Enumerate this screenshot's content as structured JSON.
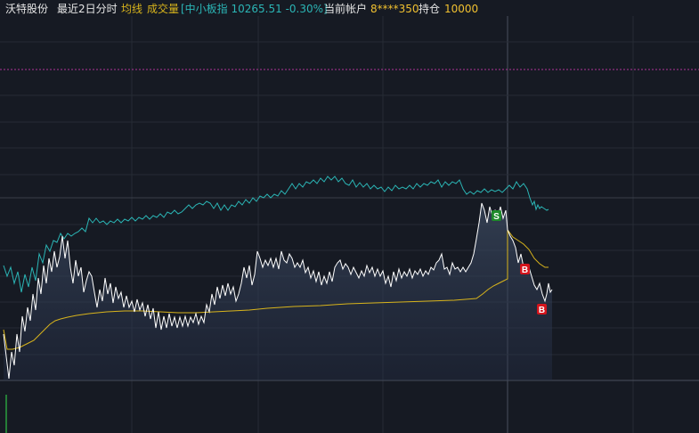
{
  "header": {
    "stock_name": "沃特股份",
    "period": "最近2日分时",
    "avg_line_label": "均线",
    "volume_label": "成交量",
    "index_info": "[中小板指 10265.51 -0.30%]",
    "account_label": "当前帐户",
    "account_id": "8****350",
    "position_label": "持仓",
    "position_value": "10000"
  },
  "markers": [
    {
      "type": "sell",
      "label": "S",
      "color": "#1e8a2a"
    },
    {
      "type": "buy",
      "label": "B",
      "color": "#d4141c"
    },
    {
      "type": "buy",
      "label": "B",
      "color": "#d4141c"
    }
  ],
  "colors": {
    "background": "#161a23",
    "price_line": "#ffffff",
    "avg_line": "#d8b41c",
    "index_line": "#2bb5b5",
    "grid": "#2c313c",
    "highlight_line": "#b0329a",
    "header_name": "#e6e6e6",
    "header_avg": "#d8b41c",
    "header_index": "#2bb5b5",
    "header_value": "#f0c030"
  }
}
